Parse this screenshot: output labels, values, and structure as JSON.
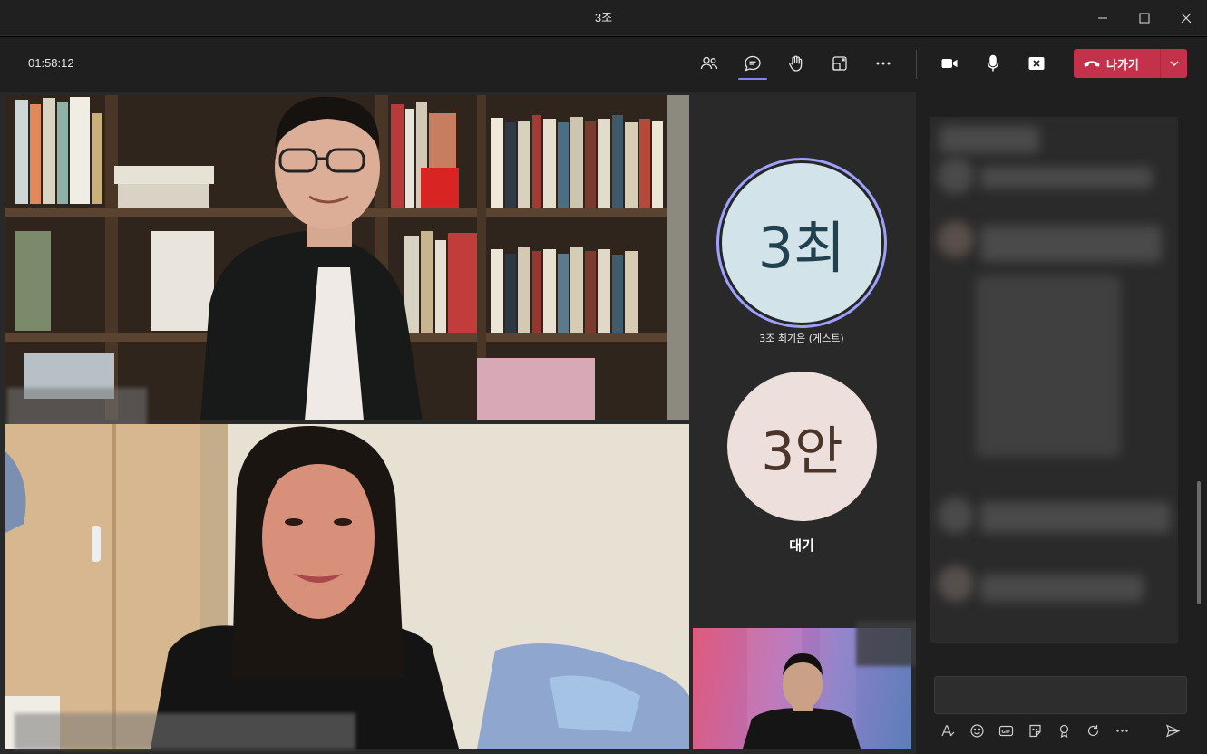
{
  "window": {
    "title": "3조"
  },
  "toolbar": {
    "timer": "01:58:12",
    "leave_label": "나가기",
    "buttons": [
      "people-icon",
      "chat-icon",
      "raise-hand-icon",
      "share-tray-icon",
      "more-icon",
      "camera-icon",
      "mic-icon",
      "share-screen-icon"
    ]
  },
  "participants": [
    {
      "initials": "3최",
      "name": "3조 최기은 (게스트)",
      "speaking": true,
      "avatar_bg": "#d3e3ea",
      "avatar_fg": "#20414e"
    },
    {
      "initials": "3안",
      "name": "대기",
      "avatar_bg": "#ede0dc",
      "avatar_fg": "#4b3429"
    }
  ],
  "chat": {
    "tools": [
      "format-icon",
      "emoji-icon",
      "gif-icon",
      "sticker-icon",
      "praise-icon",
      "loop-icon",
      "more-icon",
      "send-icon"
    ]
  },
  "colors": {
    "accent": "#7f85f5",
    "leave": "#c4314b",
    "background": "#292929"
  }
}
